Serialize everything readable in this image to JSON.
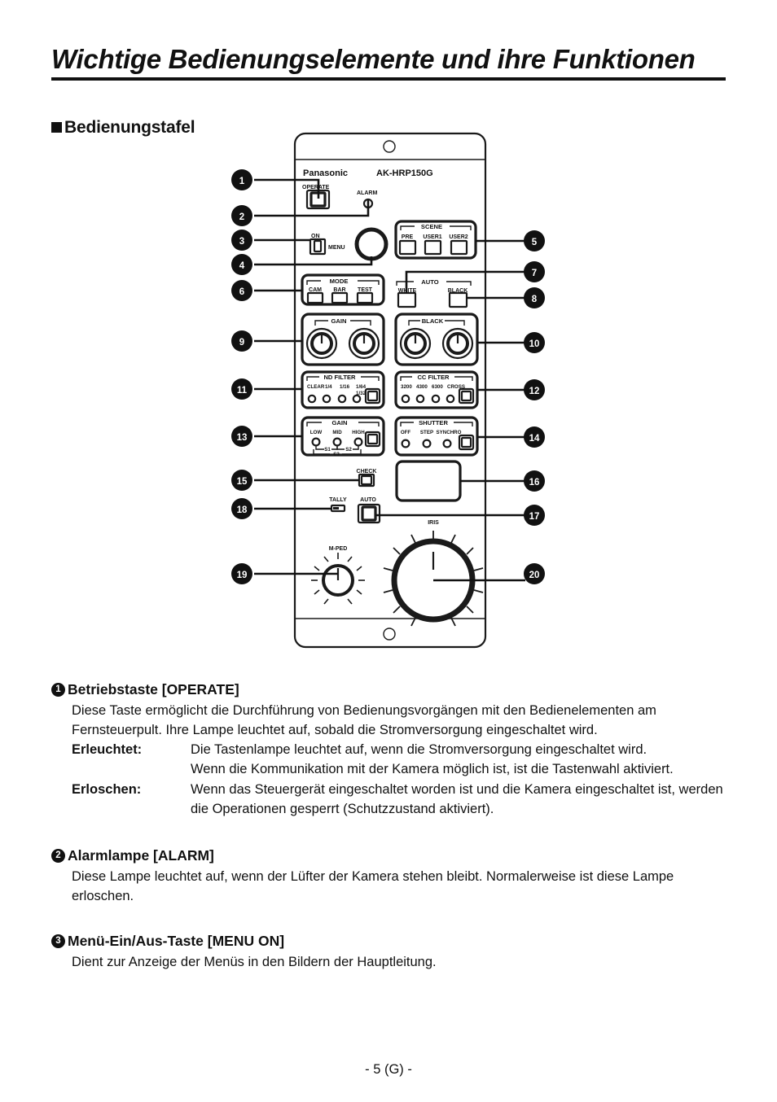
{
  "header": {
    "title": "Wichtige Bedienungselemente und ihre Funktionen",
    "subtitle": "Bedienungstafel"
  },
  "panel": {
    "brand": "Panasonic",
    "model": "AK-HRP150G",
    "labels": {
      "operate": "OPERATE",
      "alarm": "ALARM",
      "on": "ON",
      "menu": "MENU",
      "scene": "SCENE",
      "scene_pre": "PRE",
      "scene_user1": "USER1",
      "scene_user2": "USER2",
      "mode": "MODE",
      "mode_cam": "CAM",
      "mode_bar": "BAR",
      "mode_test": "TEST",
      "auto": "AUTO",
      "auto_white": "WHITE",
      "auto_black": "BLACK",
      "gain_knobs": "GAIN",
      "black_knobs": "BLACK",
      "nd_filter": "ND FILTER",
      "nd_clear": "CLEAR",
      "nd_4": "1/4",
      "nd_16": "1/16",
      "nd_64": "1/64",
      "nd_32": "1/32",
      "cc_filter": "CC FILTER",
      "cc_3200": "3200",
      "cc_4300": "4300",
      "cc_6300": "6300",
      "cc_cross": "CROSS",
      "gain_sel": "GAIN",
      "gain_low": "LOW",
      "gain_mid": "MID",
      "gain_high": "HIGH",
      "gain_s1": "S1",
      "gain_s2": "S2",
      "gain_s3": "S3",
      "shutter": "SHUTTER",
      "shutter_off": "OFF",
      "shutter_step": "STEP",
      "shutter_synchro": "SYNCHRO",
      "check": "CHECK",
      "tally": "TALLY",
      "iris_auto": "AUTO",
      "iris": "IRIS",
      "m_ped": "M-PED"
    },
    "callouts_left": [
      "1",
      "2",
      "3",
      "4",
      "6",
      "9",
      "11",
      "13",
      "15",
      "18"
    ],
    "callouts_right": [
      "5",
      "7",
      "8",
      "10",
      "12",
      "14",
      "16",
      "17",
      "20"
    ]
  },
  "items": [
    {
      "num": "1",
      "heading": "Betriebstaste [OPERATE]",
      "intro": "Diese Taste ermöglicht die Durchführung von Bedienungsvorgängen mit den Bedienelementen am Fernsteuerpult. Ihre Lampe leuchtet auf, sobald die Stromversorgung eingeschaltet wird.",
      "definitions": [
        {
          "term": "Erleuchtet:",
          "desc": "Die Tastenlampe leuchtet auf, wenn die Stromversorgung eingeschaltet wird.\nWenn die Kommunikation mit der Kamera möglich ist, ist die Tastenwahl aktiviert."
        },
        {
          "term": "Erloschen:",
          "desc": "Wenn das Steuergerät eingeschaltet worden ist und die Kamera eingeschaltet ist, werden die Operationen gesperrt (Schutzzustand aktiviert)."
        }
      ]
    },
    {
      "num": "2",
      "heading": "Alarmlampe [ALARM]",
      "intro": "Diese Lampe leuchtet auf, wenn der Lüfter der Kamera stehen bleibt. Normalerweise ist diese Lampe erloschen.",
      "definitions": []
    },
    {
      "num": "3",
      "heading": "Menü-Ein/Aus-Taste [MENU ON]",
      "intro": "Dient zur Anzeige der Menüs in den Bildern der Hauptleitung.",
      "definitions": []
    }
  ],
  "footer": {
    "page": "- 5 (G) -"
  },
  "colors": {
    "ink": "#111111",
    "panel_fill": "#ffffff",
    "line": "#1a1a1a"
  }
}
